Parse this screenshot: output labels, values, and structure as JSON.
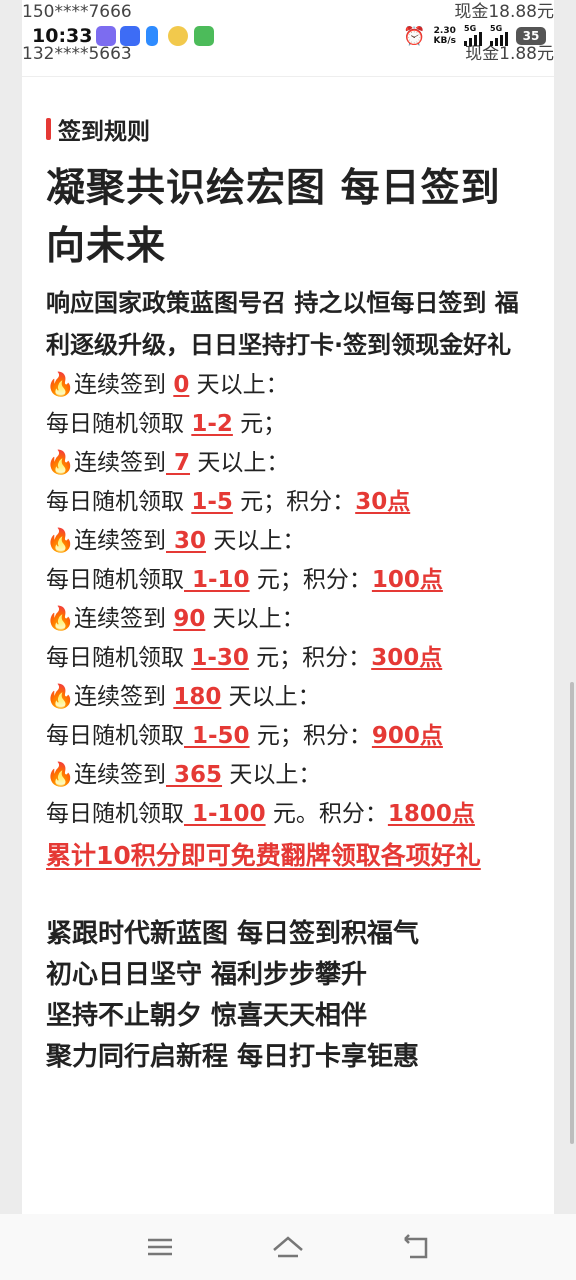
{
  "status_bar": {
    "time": "10:33",
    "net_speed": "2.30",
    "net_unit": "KB/s",
    "sig1": "5G",
    "sig2": "5G",
    "battery": "35"
  },
  "winners": [
    {
      "phone": "150****7666",
      "amount": "现金18.88元"
    },
    {
      "phone": "132****5663",
      "amount": "现金1.88元"
    }
  ],
  "section_title": "签到规则",
  "headline": "凝聚共识绘宏图 每日签到向未来",
  "subhead": "响应国家政策蓝图号召 持之以恒每日签到 福利逐级升级，日日坚持打卡·签到领现金好礼",
  "tiers": [
    {
      "pre": "连续签到 ",
      "days": "0",
      "post": " 天以上：",
      "rand_pre": "每日随机领取 ",
      "range": "1-2",
      "rand_post": " 元；",
      "points_label": "",
      "points": ""
    },
    {
      "pre": "连续签到",
      "days": " 7",
      "post": " 天以上：",
      "rand_pre": "每日随机领取 ",
      "range": "1-5",
      "rand_post": " 元；积分：",
      "points_label": "",
      "points": "30点"
    },
    {
      "pre": "连续签到",
      "days": " 30",
      "post": " 天以上：",
      "rand_pre": "每日随机领取",
      "range": " 1-10",
      "rand_post": " 元；积分：",
      "points_label": "",
      "points": "100点"
    },
    {
      "pre": "连续签到 ",
      "days": "90",
      "post": " 天以上：",
      "rand_pre": "每日随机领取 ",
      "range": "1-30",
      "rand_post": " 元；积分：",
      "points_label": "",
      "points": "300点"
    },
    {
      "pre": "连续签到 ",
      "days": "180",
      "post": " 天以上：",
      "rand_pre": "每日随机领取",
      "range": " 1-50",
      "rand_post": " 元；积分：",
      "points_label": "",
      "points": "900点"
    },
    {
      "pre": "连续签到",
      "days": " 365",
      "post": " 天以上：",
      "rand_pre": "每日随机领取",
      "range": " 1-100",
      "rand_post": " 元。积分：",
      "points_label": "",
      "points": "1800点"
    }
  ],
  "note": "累计10积分即可免费翻牌领取各项好礼",
  "slogans": [
    "紧跟时代新蓝图 每日签到积福气",
    "初心日日坚守 福利步步攀升",
    "坚持不止朝夕 惊喜天天相伴",
    "聚力同行启新程 每日打卡享钜惠"
  ],
  "icons": {
    "fire": "🔥",
    "menu": "menu-icon",
    "home": "home-icon",
    "back": "back-icon"
  },
  "colors": {
    "accent": "#e53935"
  }
}
